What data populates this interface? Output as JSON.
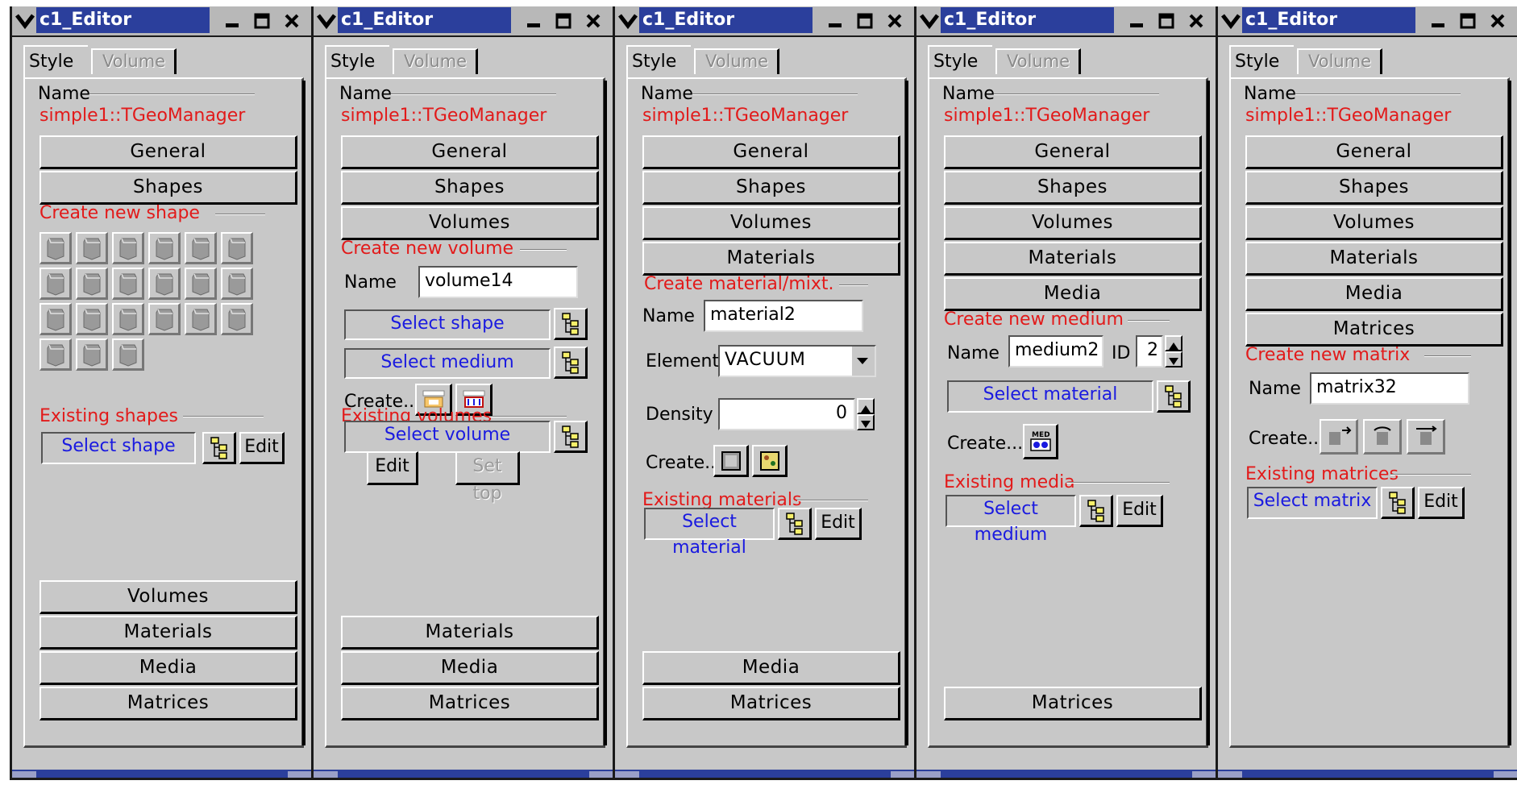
{
  "common": {
    "window_title": "c1_Editor",
    "tab_style": "Style",
    "tab_volume": "Volume",
    "name_label": "Name",
    "object_name": "simple1::TGeoManager",
    "accent_title": "#2b3f9c",
    "label_red": "#e21a1a",
    "label_blue": "#1a1ae0"
  },
  "w1": {
    "btn_general": "General",
    "btn_shapes": "Shapes",
    "create_header": "Create new shape",
    "shape_icons": [
      "tube-shape-icon",
      "para-shape-icon",
      "cone-shape-icon",
      "tubeseg-shape-icon",
      "coneseg-shape-icon",
      "pcon-shape-icon",
      "pgon-shape-icon",
      "trd1-shape-icon",
      "ctub-shape-icon",
      "trd2-shape-icon",
      "sphere-shape-icon",
      "arb8-shape-icon",
      "torus-shape-icon",
      "trap-shape-icon",
      "eltu-shape-icon",
      "gtra-shape-icon",
      "hype-shape-icon",
      "xtru-shape-icon",
      "composite-shape-icon",
      "box-shape-icon",
      "paraboloid-shape-icon"
    ],
    "existing_header": "Existing shapes",
    "select_shape": "Select shape",
    "edit": "Edit",
    "btn_volumes": "Volumes",
    "btn_materials": "Materials",
    "btn_media": "Media",
    "btn_matrices": "Matrices"
  },
  "w2": {
    "btn_general": "General",
    "btn_shapes": "Shapes",
    "btn_volumes": "Volumes",
    "create_header": "Create new volume",
    "name_label": "Name",
    "name_value": "volume14",
    "select_shape": "Select shape",
    "select_medium": "Select medium",
    "create_label": "Create...",
    "existing_header": "Existing volumes",
    "select_volume": "Select volume",
    "edit": "Edit",
    "set_top": "Set top",
    "btn_materials": "Materials",
    "btn_media": "Media",
    "btn_matrices": "Matrices"
  },
  "w3": {
    "btn_general": "General",
    "btn_shapes": "Shapes",
    "btn_volumes": "Volumes",
    "btn_materials": "Materials",
    "create_header": "Create material/mixt.",
    "name_label": "Name",
    "name_value": "material2",
    "element_label": "Element",
    "element_value": "VACUUM",
    "density_label": "Density",
    "density_value": "0",
    "create_label": "Create...",
    "existing_header": "Existing materials",
    "select_material": "Select material",
    "edit": "Edit",
    "btn_media": "Media",
    "btn_matrices": "Matrices"
  },
  "w4": {
    "btn_general": "General",
    "btn_shapes": "Shapes",
    "btn_volumes": "Volumes",
    "btn_materials": "Materials",
    "btn_media": "Media",
    "create_header": "Create new medium",
    "name_label": "Name",
    "name_value": "medium2",
    "id_label": "ID",
    "id_value": "2",
    "select_material": "Select material",
    "create_label": "Create...",
    "med_icon_text": "MED",
    "existing_header": "Existing media",
    "select_medium": "Select medium",
    "edit": "Edit",
    "btn_matrices": "Matrices"
  },
  "w5": {
    "btn_general": "General",
    "btn_shapes": "Shapes",
    "btn_volumes": "Volumes",
    "btn_materials": "Materials",
    "btn_media": "Media",
    "btn_matrices": "Matrices",
    "create_header": "Create new matrix",
    "name_label": "Name",
    "name_value": "matrix32",
    "create_label": "Create...",
    "existing_header": "Existing matrices",
    "select_matrix": "Select matrix",
    "edit": "Edit"
  }
}
